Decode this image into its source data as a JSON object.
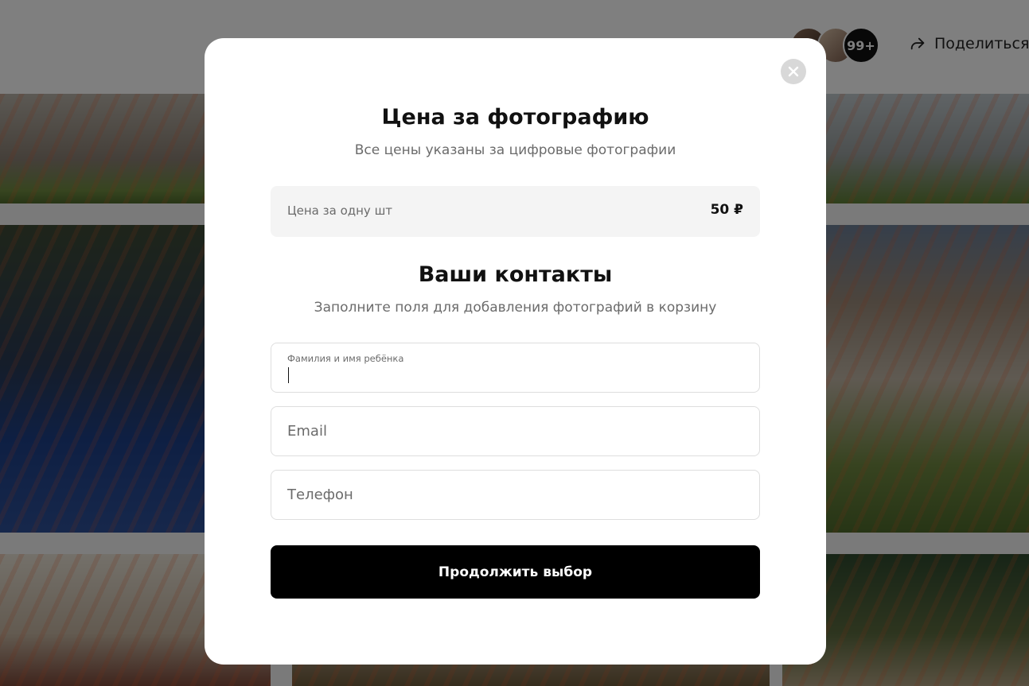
{
  "header": {
    "avatar_count": "99+",
    "share_label": "Поделиться"
  },
  "modal": {
    "title": "Цена за фотографию",
    "subtitle": "Все цены указаны за цифровые фотографии",
    "price": {
      "label": "Цена за одну шт",
      "value": "50 ₽"
    },
    "contacts_title": "Ваши контакты",
    "contacts_subtitle": "Заполните поля для добавления фотографий в корзину",
    "fields": {
      "child_name_label": "Фамилия и имя ребёнка",
      "child_name_value": "",
      "email_placeholder": "Email",
      "phone_placeholder": "Телефон"
    },
    "continue_label": "Продолжить выбор"
  },
  "colors": {
    "overlay": "rgba(0,0,0,0.5)",
    "button_bg": "#000000",
    "price_bg": "#f4f4f4"
  }
}
